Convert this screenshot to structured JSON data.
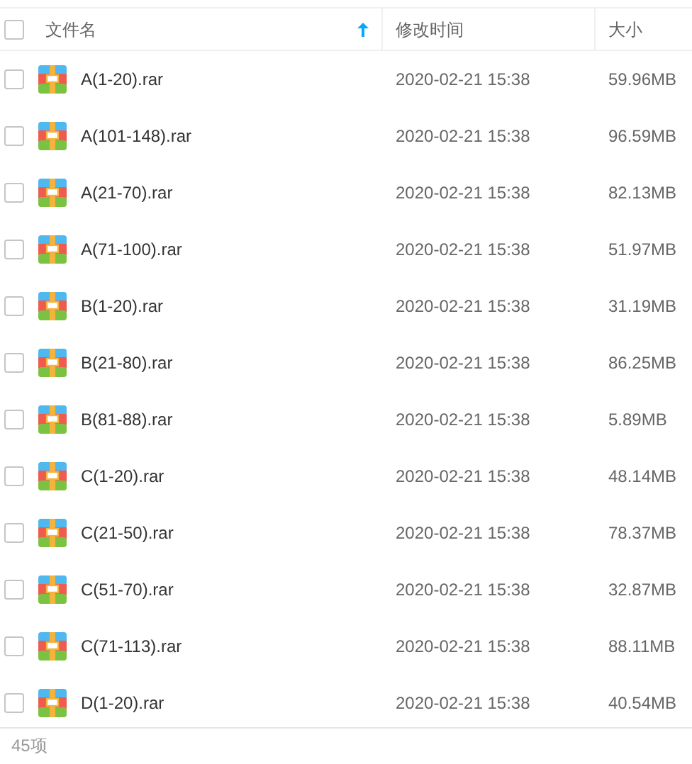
{
  "header": {
    "checked": false,
    "columns": [
      {
        "label": "文件名",
        "sorted": true
      },
      {
        "label": "修改时间",
        "sorted": false
      },
      {
        "label": "大小",
        "sorted": false
      }
    ]
  },
  "rows": [
    {
      "checked": false,
      "name": "A(1-20).rar",
      "modified": "2020-02-21 15:38",
      "size": "59.96MB"
    },
    {
      "checked": false,
      "name": "A(101-148).rar",
      "modified": "2020-02-21 15:38",
      "size": "96.59MB"
    },
    {
      "checked": false,
      "name": "A(21-70).rar",
      "modified": "2020-02-21 15:38",
      "size": "82.13MB"
    },
    {
      "checked": false,
      "name": "A(71-100).rar",
      "modified": "2020-02-21 15:38",
      "size": "51.97MB"
    },
    {
      "checked": false,
      "name": "B(1-20).rar",
      "modified": "2020-02-21 15:38",
      "size": "31.19MB"
    },
    {
      "checked": false,
      "name": "B(21-80).rar",
      "modified": "2020-02-21 15:38",
      "size": "86.25MB"
    },
    {
      "checked": false,
      "name": "B(81-88).rar",
      "modified": "2020-02-21 15:38",
      "size": "5.89MB"
    },
    {
      "checked": false,
      "name": "C(1-20).rar",
      "modified": "2020-02-21 15:38",
      "size": "48.14MB"
    },
    {
      "checked": false,
      "name": "C(21-50).rar",
      "modified": "2020-02-21 15:38",
      "size": "78.37MB"
    },
    {
      "checked": false,
      "name": "C(51-70).rar",
      "modified": "2020-02-21 15:38",
      "size": "32.87MB"
    },
    {
      "checked": false,
      "name": "C(71-113).rar",
      "modified": "2020-02-21 15:38",
      "size": "88.11MB"
    },
    {
      "checked": false,
      "name": "D(1-20).rar",
      "modified": "2020-02-21 15:38",
      "size": "40.54MB"
    }
  ],
  "status_bar": {
    "count": "45项"
  }
}
